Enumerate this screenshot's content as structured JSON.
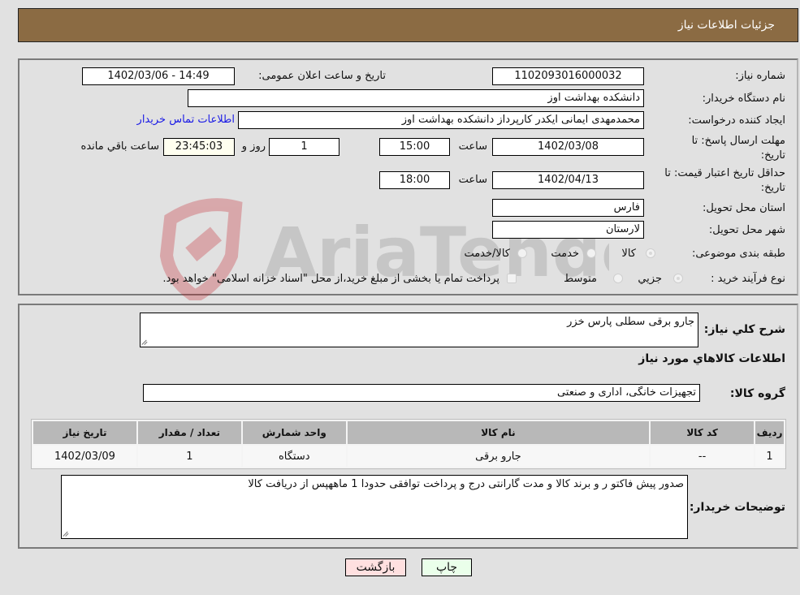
{
  "header": {
    "title": "جزئیات اطلاعات نیاز"
  },
  "form": {
    "need_number": {
      "label": "شماره نیاز:",
      "value": "1102093016000032"
    },
    "announce_datetime": {
      "label": "تاریخ و ساعت اعلان عمومی:",
      "value": "1402/03/06 - 14:49"
    },
    "buyer_org": {
      "label": "نام دستگاه خریدار:",
      "value": "دانشکده بهداشت اوز"
    },
    "requester": {
      "label": "ایجاد کننده درخواست:",
      "value": "محمدمهدی ایمانی ایکدر کارپرداز دانشکده بهداشت اوز",
      "contact_link": "اطلاعات تماس خریدار"
    },
    "response_deadline": {
      "label_line1": "مهلت ارسال پاسخ: تا",
      "label_line2": "تاریخ:",
      "date": "1402/03/08",
      "time_label": "ساعت",
      "time": "15:00",
      "days": "1",
      "days_label": "روز و",
      "remaining": "23:45:03",
      "remaining_label": "ساعت باقي مانده"
    },
    "price_validity": {
      "label_line1": "حداقل تاریخ اعتبار قیمت: تا",
      "label_line2": "تاریخ:",
      "date": "1402/04/13",
      "time_label": "ساعت",
      "time": "18:00"
    },
    "delivery_province": {
      "label": "استان محل تحویل:",
      "value": "فارس"
    },
    "delivery_city": {
      "label": "شهر محل تحویل:",
      "value": "لارستان"
    },
    "category": {
      "label": "طبقه بندی موضوعی:",
      "options": [
        "کالا",
        "خدمت",
        "کالا/خدمت"
      ],
      "selected": "کالا"
    },
    "purchase_type": {
      "label": "نوع فرآیند خرید :",
      "options": [
        "جزيي",
        "متوسط"
      ],
      "selected": "جزيي",
      "treasury_note": "پرداخت تمام یا بخشی از مبلغ خرید،از محل \"اسناد خزانه اسلامی\" خواهد بود."
    }
  },
  "details": {
    "description": {
      "label": "شرح کلي نياز:",
      "value": "جارو برقی سطلی پارس خزر"
    },
    "items_heading": "اطلاعات کالاهاي مورد نياز",
    "goods_group": {
      "label": "گروه کالا:",
      "value": "تجهیزات خانگی، اداری و صنعتی"
    },
    "table": {
      "headers": [
        "ردیف",
        "کد کالا",
        "نام کالا",
        "واحد شمارش",
        "تعداد / مقدار",
        "تاریخ نیاز"
      ],
      "rows": [
        [
          "1",
          "--",
          "جارو برقی",
          "دستگاه",
          "1",
          "1402/03/09"
        ]
      ]
    },
    "buyer_notes": {
      "label": "توضیحات خریدار:",
      "value": "صدور پیش فاکتو ر و برند کالا و مدت گارانتی درج و پرداخت توافقی حدودا 1 ماههپس از دریافت کالا"
    }
  },
  "buttons": {
    "print": "چاپ",
    "back": "بازگشت"
  },
  "watermark": {
    "text": "AriaTender.neT"
  },
  "colors": {
    "header_bg": "#8b6b43",
    "print_bg": "#eaffea",
    "back_bg": "#ffe0e0",
    "link": "#1a1ae6"
  }
}
